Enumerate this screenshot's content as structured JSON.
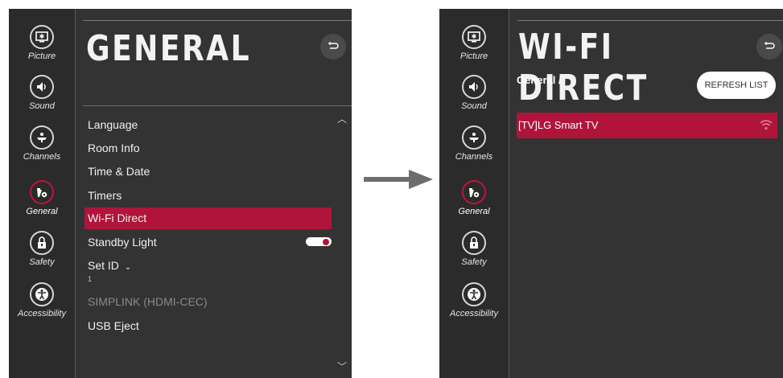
{
  "sidebar": {
    "items": [
      {
        "label": "Picture",
        "icon": "picture-icon"
      },
      {
        "label": "Sound",
        "icon": "speaker-icon"
      },
      {
        "label": "Channels",
        "icon": "antenna-icon"
      },
      {
        "label": "General",
        "icon": "wrench-gear-icon",
        "active": true
      },
      {
        "label": "Safety",
        "icon": "lock-icon"
      },
      {
        "label": "Accessibility",
        "icon": "accessibility-icon"
      }
    ]
  },
  "general_screen": {
    "title": "GENERAL",
    "menu": {
      "language": "Language",
      "room_info": "Room Info",
      "time_date": "Time & Date",
      "timers": "Timers",
      "wifi_direct": "Wi-Fi Direct",
      "standby_light": "Standby Light",
      "set_id": "Set ID",
      "set_id_value": "1",
      "simplink": "SIMPLINK (HDMI-CEC)",
      "usb_eject": "USB Eject"
    },
    "standby_light_on": true
  },
  "wifi_direct_screen": {
    "title": "WI-FI DIRECT",
    "breadcrumb": "General /",
    "refresh_label": "REFRESH LIST",
    "devices": [
      {
        "name": "[TV]LG Smart TV"
      }
    ]
  },
  "colors": {
    "panel_bg": "#333333",
    "sidebar_bg": "#2b2b2b",
    "accent": "#b0143a",
    "text": "#f0f0f0",
    "disabled_text": "#8a8a8a",
    "arrow": "#6d6d6d"
  }
}
